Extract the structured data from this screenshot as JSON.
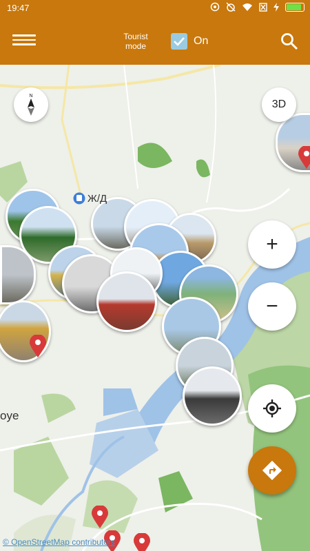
{
  "status_bar": {
    "time": "19:47"
  },
  "app_bar": {
    "tourist_mode_label": "Tourist mode",
    "tourist_mode_state": "On",
    "tourist_mode_checked": true
  },
  "map": {
    "labels": {
      "station": "Ж/Д",
      "town_fragment": "oye"
    },
    "attribution": "© OpenStreetMap contributors",
    "buttons": {
      "three_d": "3D",
      "zoom_in": "+",
      "zoom_out": "−"
    }
  },
  "colors": {
    "accent": "#c8780c",
    "water": "#9fc2e7",
    "park": "#7bb661",
    "pin": "#d83a3a"
  }
}
